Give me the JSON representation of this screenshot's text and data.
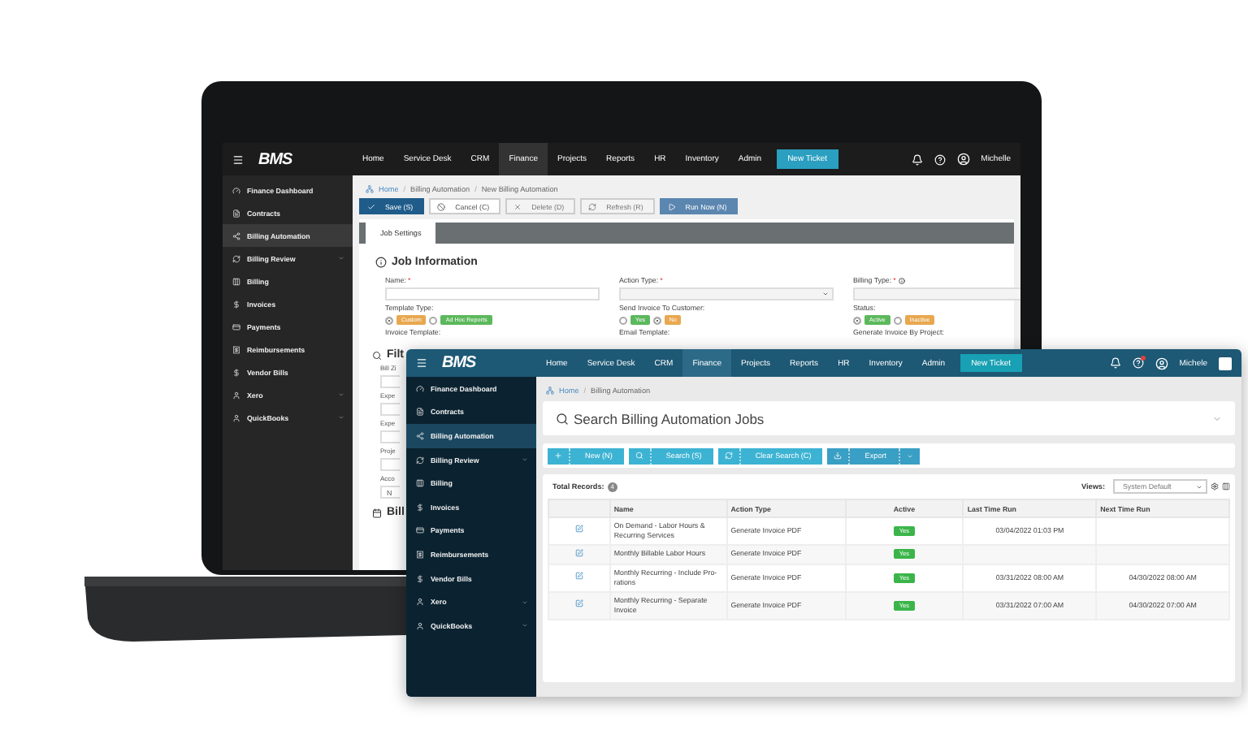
{
  "laptop": {
    "header": {
      "logo": "BMS",
      "nav": [
        {
          "label": "Home",
          "selected": false
        },
        {
          "label": "Service Desk",
          "selected": false
        },
        {
          "label": "CRM",
          "selected": false
        },
        {
          "label": "Finance",
          "selected": true
        },
        {
          "label": "Projects",
          "selected": false
        },
        {
          "label": "Reports",
          "selected": false
        },
        {
          "label": "HR",
          "selected": false
        },
        {
          "label": "Inventory",
          "selected": false
        },
        {
          "label": "Admin",
          "selected": false
        }
      ],
      "new_ticket": "New Ticket",
      "user": "Michelle"
    },
    "sidebar": [
      {
        "label": "Finance Dashboard",
        "selected": false,
        "expandable": false
      },
      {
        "label": "Contracts",
        "selected": false,
        "expandable": false
      },
      {
        "label": "Billing Automation",
        "selected": true,
        "expandable": false
      },
      {
        "label": "Billing Review",
        "selected": false,
        "expandable": true
      },
      {
        "label": "Billing",
        "selected": false,
        "expandable": false
      },
      {
        "label": "Invoices",
        "selected": false,
        "expandable": false
      },
      {
        "label": "Payments",
        "selected": false,
        "expandable": false
      },
      {
        "label": "Reimbursements",
        "selected": false,
        "expandable": false
      },
      {
        "label": "Vendor Bills",
        "selected": false,
        "expandable": false
      },
      {
        "label": "Xero",
        "selected": false,
        "expandable": true
      },
      {
        "label": "QuickBooks",
        "selected": false,
        "expandable": true
      }
    ],
    "breadcrumb": {
      "items": [
        "Home",
        "Billing Automation",
        "New Billing Automation"
      ],
      "separators": [
        "/",
        "/"
      ]
    },
    "toolbar": [
      {
        "label": "Save (S)",
        "kind": "primary",
        "disabled": false
      },
      {
        "label": "Cancel (C)",
        "kind": "default",
        "disabled": false
      },
      {
        "label": "Delete (D)",
        "kind": "default",
        "disabled": true
      },
      {
        "label": "Refresh (R)",
        "kind": "default",
        "disabled": true
      },
      {
        "label": "Run Now (N)",
        "kind": "run",
        "disabled": false
      }
    ],
    "tabs": [
      {
        "label": "Job Settings",
        "selected": true
      }
    ],
    "section_title": "Job Information",
    "fields": [
      {
        "label": "Name:",
        "mark": "*",
        "kind": "text",
        "info": false
      },
      {
        "label": "Action Type:",
        "mark": "*",
        "kind": "select",
        "info": false
      },
      {
        "label": "Billing Type:",
        "mark": "*",
        "kind": "select",
        "info": true
      }
    ],
    "options": [
      {
        "label": "Template Type:",
        "choices": [
          {
            "label": "Custom",
            "color": "#e8a850",
            "selected": true
          },
          {
            "label": "Ad Hoc Reports",
            "color": "#5cb85c",
            "selected": false
          }
        ]
      },
      {
        "label": "Send Invoice To Customer:",
        "choices": [
          {
            "label": "Yes",
            "color": "#5cb85c",
            "selected": false
          },
          {
            "label": "No",
            "color": "#e8a850",
            "selected": true
          }
        ]
      },
      {
        "label": "Status:",
        "choices": [
          {
            "label": "Active",
            "color": "#5cb85c",
            "selected": true
          },
          {
            "label": "Inactive",
            "color": "#e8a850",
            "selected": false
          }
        ]
      }
    ],
    "template_labels": [
      "Invoice Template:",
      "Email Template:",
      "Generate Invoice By Project:"
    ],
    "filters": {
      "title": "Filt",
      "labels": [
        "Bill Zi",
        "Expe",
        "Expe",
        "Proje",
        "Acco"
      ],
      "value": "N"
    },
    "next_section": "Bill"
  },
  "window": {
    "header": {
      "logo": "BMS",
      "nav": [
        {
          "label": "Home",
          "selected": false
        },
        {
          "label": "Service Desk",
          "selected": false
        },
        {
          "label": "CRM",
          "selected": false
        },
        {
          "label": "Finance",
          "selected": true
        },
        {
          "label": "Projects",
          "selected": false
        },
        {
          "label": "Reports",
          "selected": false
        },
        {
          "label": "HR",
          "selected": false
        },
        {
          "label": "Inventory",
          "selected": false
        },
        {
          "label": "Admin",
          "selected": false
        }
      ],
      "new_ticket": "New Ticket",
      "user": "Michele"
    },
    "sidebar": [
      {
        "label": "Finance Dashboard",
        "selected": false,
        "expandable": false
      },
      {
        "label": "Contracts",
        "selected": false,
        "expandable": false
      },
      {
        "label": "Billing Automation",
        "selected": true,
        "expandable": false
      },
      {
        "label": "Billing Review",
        "selected": false,
        "expandable": true
      },
      {
        "label": "Billing",
        "selected": false,
        "expandable": false
      },
      {
        "label": "Invoices",
        "selected": false,
        "expandable": false
      },
      {
        "label": "Payments",
        "selected": false,
        "expandable": false
      },
      {
        "label": "Reimbursements",
        "selected": false,
        "expandable": false
      },
      {
        "label": "Vendor Bills",
        "selected": false,
        "expandable": false
      },
      {
        "label": "Xero",
        "selected": false,
        "expandable": true
      },
      {
        "label": "QuickBooks",
        "selected": false,
        "expandable": true
      }
    ],
    "breadcrumb": {
      "items": [
        "Home",
        "Billing Automation"
      ],
      "separators": [
        "/"
      ]
    },
    "title": "Search Billing Automation Jobs",
    "buttons": [
      {
        "label": "New (N)",
        "kind": "new"
      },
      {
        "label": "Search (S)",
        "kind": "search"
      },
      {
        "label": "Clear Search (C)",
        "kind": "clear"
      },
      {
        "label": "Export",
        "kind": "export"
      }
    ],
    "total_label": "Total Records:",
    "total": "4",
    "views_label": "Views:",
    "views_value": "System Default",
    "table": {
      "columns": [
        "Name",
        "Action Type",
        "Active",
        "Last Time Run",
        "Next Time Run"
      ],
      "rows": [
        {
          "name": "On Demand - Labor Hours & Recurring Services",
          "action_type": "Generate Invoice PDF",
          "active": "Yes",
          "last_run": "03/04/2022 01:03 PM"
        },
        {
          "name": "Monthly Billable Labor Hours",
          "action_type": "Generate Invoice PDF",
          "active": "Yes"
        },
        {
          "name": "Monthly Recurring - Include Pro-rations",
          "action_type": "Generate Invoice PDF",
          "active": "Yes",
          "last_run": "03/31/2022 08:00 AM",
          "next_run": "04/30/2022 08:00 AM"
        },
        {
          "name": "Monthly Recurring - Separate Invoice",
          "action_type": "Generate Invoice PDF",
          "active": "Yes",
          "last_run": "03/31/2022 07:00 AM",
          "next_run": "04/30/2022 07:00 AM"
        }
      ]
    }
  }
}
